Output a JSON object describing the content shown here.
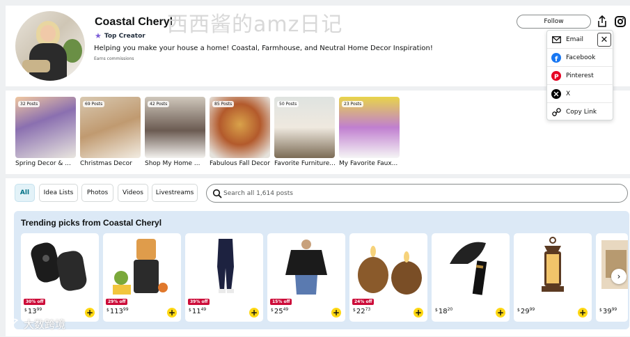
{
  "profile": {
    "name": "Coastal Cheryl",
    "badge": "Top Creator",
    "tagline": "Helping you make your house a home! Coastal, Farmhouse, and Neutral Home Decor Inspiration!",
    "earns": "Earns commissions",
    "follow_label": "Follow",
    "overlay_watermark": "西西酱的amz日记"
  },
  "share_menu": {
    "items": [
      {
        "label": "Email",
        "icon": "email-icon"
      },
      {
        "label": "Facebook",
        "icon": "facebook-icon"
      },
      {
        "label": "Pinterest",
        "icon": "pinterest-icon"
      },
      {
        "label": "X",
        "icon": "x-icon"
      },
      {
        "label": "Copy Link",
        "icon": "link-icon"
      }
    ],
    "close": "✕"
  },
  "idea_lists": [
    {
      "label": "Spring Decor & ...",
      "count": "32 Posts",
      "colors": [
        "#f0c7a0",
        "#8a6fb0",
        "#e9e6df"
      ]
    },
    {
      "label": "Christmas Decor",
      "count": "69 Posts",
      "colors": [
        "#d8c8b0",
        "#c09a70",
        "#f2ece2"
      ]
    },
    {
      "label": "Shop My Home ...",
      "count": "42 Posts",
      "colors": [
        "#cfc7bb",
        "#6b5b52",
        "#f3f1ee"
      ]
    },
    {
      "label": "Fabulous Fall Decor!",
      "count": "85 Posts",
      "colors": [
        "#d9a24a",
        "#b35a2c",
        "#e5e2dc"
      ]
    },
    {
      "label": "Favorite Furniture...",
      "count": "50 Posts",
      "colors": [
        "#efe9df",
        "#7b6b55",
        "#dfe3e0"
      ]
    },
    {
      "label": "My Favorite Faux...",
      "count": "23 Posts",
      "colors": [
        "#e8d44a",
        "#c07fd0",
        "#f5f5f5"
      ]
    }
  ],
  "filters": {
    "chips": [
      "All",
      "Idea Lists",
      "Photos",
      "Videos",
      "Livestreams"
    ],
    "search_placeholder": "Search all 1,614 posts"
  },
  "trending": {
    "title": "Trending picks from Coastal Cheryl",
    "products": [
      {
        "discount": "30% off",
        "currency": "$",
        "whole": "13",
        "fraction": "99",
        "colors": [
          "#1c1c1c",
          "#444"
        ]
      },
      {
        "discount": "29% off",
        "currency": "$",
        "whole": "113",
        "fraction": "99",
        "colors": [
          "#d98b2b",
          "#2b2b2b"
        ]
      },
      {
        "discount": "39% off",
        "currency": "$",
        "whole": "11",
        "fraction": "49",
        "colors": [
          "#1d2240",
          "#eaeaea"
        ]
      },
      {
        "discount": "15% off",
        "currency": "$",
        "whole": "25",
        "fraction": "49",
        "colors": [
          "#1b1b1b",
          "#5a7ab0"
        ]
      },
      {
        "discount": "24% off",
        "currency": "$",
        "whole": "22",
        "fraction": "73",
        "colors": [
          "#8a5a2b",
          "#f6d27a"
        ]
      },
      {
        "discount": "",
        "currency": "$",
        "whole": "18",
        "fraction": "20",
        "colors": [
          "#222",
          "#b58a3a"
        ]
      },
      {
        "discount": "",
        "currency": "$",
        "whole": "29",
        "fraction": "99",
        "colors": [
          "#5b3a22",
          "#f1c46a"
        ]
      },
      {
        "discount": "",
        "currency": "$",
        "whole": "39",
        "fraction": "99",
        "colors": [
          "#e8d8c0",
          "#b79a70"
        ]
      }
    ]
  },
  "footer_watermark": "大数跨境",
  "accent": "#ffd814"
}
